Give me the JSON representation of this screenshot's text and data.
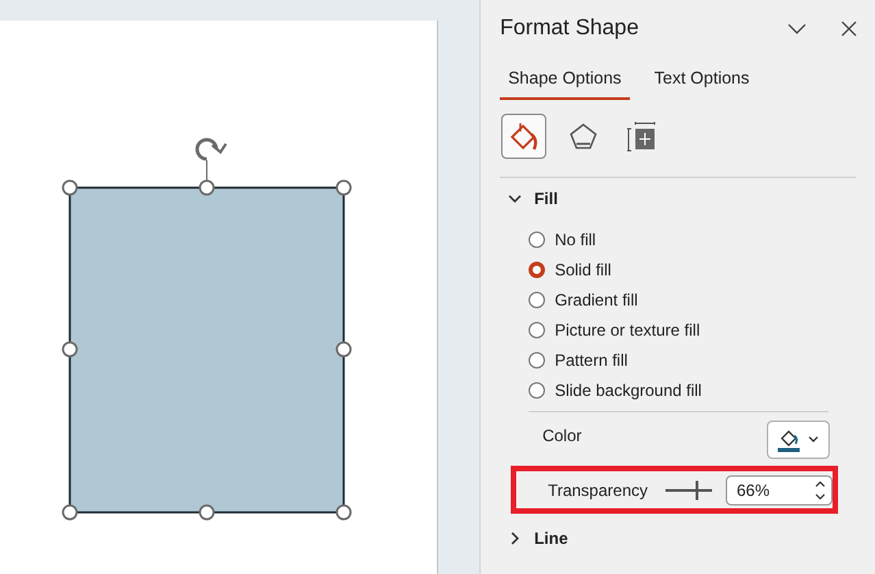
{
  "pane": {
    "title": "Format Shape"
  },
  "tabs": [
    {
      "label": "Shape Options",
      "selected": true
    },
    {
      "label": "Text Options",
      "selected": false
    }
  ],
  "icon_tabs": [
    {
      "kind": "fill",
      "selected": true
    },
    {
      "kind": "effects",
      "selected": false
    },
    {
      "kind": "size",
      "selected": false
    }
  ],
  "fill_section": {
    "label": "Fill",
    "expanded": true,
    "options": [
      {
        "label": "No fill",
        "selected": false
      },
      {
        "label": "Solid fill",
        "selected": true
      },
      {
        "label": "Gradient fill",
        "selected": false
      },
      {
        "label": "Picture or texture fill",
        "selected": false
      },
      {
        "label": "Pattern fill",
        "selected": false
      },
      {
        "label": "Slide background fill",
        "selected": false
      }
    ],
    "color": {
      "label": "Color"
    },
    "transparency": {
      "label": "Transparency",
      "level": 0.66,
      "value": "66%",
      "highlighted": true
    }
  },
  "line_section": {
    "label": "Line",
    "expanded": false
  }
}
